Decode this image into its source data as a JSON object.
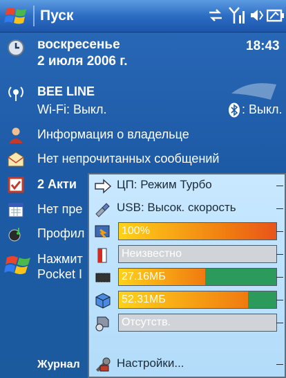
{
  "titlebar": {
    "title": "Пуск",
    "start_icon": "windows-flag-icon",
    "status_icons": [
      "sync-icon",
      "signal-icon",
      "volume-icon",
      "battery-icon"
    ]
  },
  "today": {
    "date": {
      "day": "воскресенье",
      "date": "2 июля 2006 г.",
      "time": "18:43"
    },
    "network": {
      "name": "BEE LINE",
      "wifi": "Wi-Fi: Выкл.",
      "bluetooth": ": Выкл."
    },
    "owner": "Информация о владельце",
    "messages": "Нет непрочитанных сообщений",
    "tasks": "2 Акти",
    "calendar": "Нет пре",
    "profile": "Профил",
    "help_line1": "Нажмит",
    "help_line2": "Pocket I",
    "bottom_left": "Журнал"
  },
  "popup": {
    "cpu_label": "ЦП: Режим Турбо",
    "usb_label": "USB: Высок. скорость",
    "battery": {
      "label": "100%",
      "level": 1.0
    },
    "backup_battery": {
      "label": "Неизвестно",
      "level": 0
    },
    "ram": {
      "label": "27.16МБ",
      "level": 0.55
    },
    "storage": {
      "label": "52.31МБ",
      "level": 0.82
    },
    "card": {
      "label": "Отсутств.",
      "level": 0
    },
    "settings_label": "Настройки..."
  },
  "colors": {
    "accent": "#2c6dc4",
    "bar_orange": "#f07a10",
    "bar_yellow": "#ffd21a",
    "bar_green": "#2c9a5a",
    "bar_gray": "#c8ccd0"
  }
}
